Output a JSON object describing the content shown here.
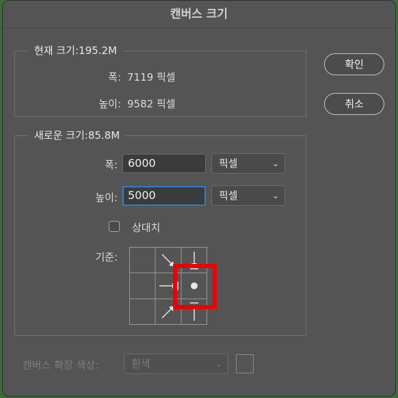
{
  "dialog": {
    "title": "캔버스 크기"
  },
  "current_size": {
    "legend": "현재 크기:195.2M",
    "width_label": "폭:",
    "width_value": "7119 픽셀",
    "height_label": "높이:",
    "height_value": "9582 픽셀"
  },
  "new_size": {
    "legend": "새로운 크기:85.8M",
    "width_label": "폭:",
    "width_value": "6000",
    "width_unit": "픽셀",
    "height_label": "높이:",
    "height_value": "5000",
    "height_unit": "픽셀",
    "relative_label": "상대치",
    "relative_checked": false,
    "anchor_label": "기준:",
    "anchor_selected": "center"
  },
  "buttons": {
    "ok": "확인",
    "cancel": "취소"
  },
  "extension": {
    "label": "캔버스 확장 색상:",
    "value": "흰색"
  },
  "colors": {
    "focus": "#2e7cd6",
    "highlight": "#ee0000"
  }
}
